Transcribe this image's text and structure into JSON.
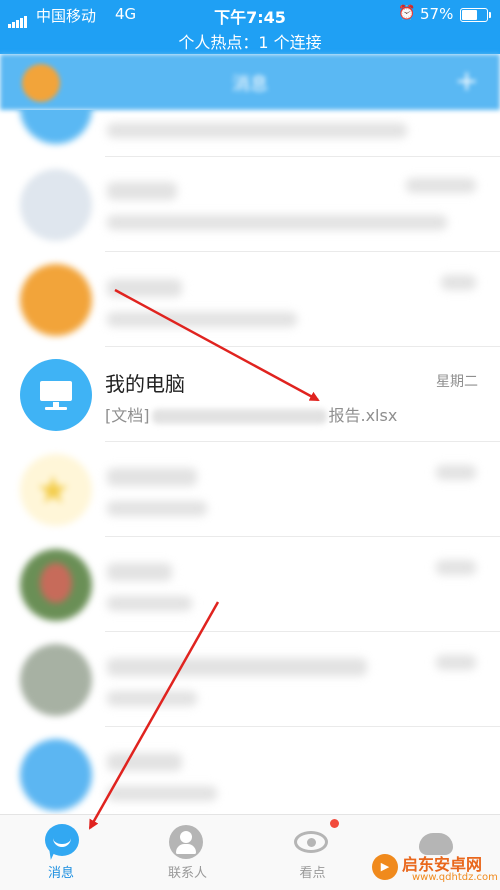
{
  "status_bar": {
    "carrier": "中国移动",
    "network": "4G",
    "time": "下午7:45",
    "battery_percent": "57%",
    "battery_level": 0.57,
    "hotspot_text": "个人热点：1 个连接",
    "alarm_icon": "alarm-clock-icon",
    "signal_bars": 5
  },
  "header": {
    "title": "消息",
    "add_icon": "plus-icon"
  },
  "conversations": [
    {
      "id": "partial-top",
      "name": "",
      "preview": "",
      "time": "",
      "blurred": true,
      "avatar_color": "#5ab8f3"
    },
    {
      "id": "contact-1",
      "name": "",
      "preview": "",
      "time": "",
      "blurred": true,
      "avatar_color": "#dfe6ee"
    },
    {
      "id": "contact-2",
      "name": "",
      "preview": "",
      "time": "",
      "blurred": true,
      "avatar_color": "#f2a43a"
    },
    {
      "id": "my-computer",
      "name": "我的电脑",
      "preview_prefix": "[文档]",
      "preview_suffix": "报告.xlsx",
      "time": "星期二",
      "blurred": false,
      "avatar_color": "#3fb3f5",
      "avatar_icon": "monitor-icon"
    },
    {
      "id": "contact-4",
      "name": "",
      "preview": "",
      "time": "",
      "blurred": true,
      "avatar_color": "#f3cd4c"
    },
    {
      "id": "contact-5",
      "name": "",
      "preview": "",
      "time": "",
      "blurred": true,
      "avatar_color": "#6a8f56"
    },
    {
      "id": "contact-6",
      "name": "",
      "preview": "",
      "time": "",
      "blurred": true,
      "avatar_color": "#a7b1a3"
    },
    {
      "id": "contact-7",
      "name": "",
      "preview": "",
      "time": "",
      "blurred": true,
      "avatar_color": "#5cb6f2"
    }
  ],
  "tabs": [
    {
      "label": "消息",
      "icon": "message-bubble-icon",
      "active": true
    },
    {
      "label": "联系人",
      "icon": "contacts-icon",
      "active": false
    },
    {
      "label": "看点",
      "icon": "eye-icon",
      "active": false,
      "badge": true
    },
    {
      "label": "",
      "icon": "cloud-icon",
      "active": false
    }
  ],
  "watermark": {
    "name": "启东安卓网",
    "url": "www.qdhtdz.com"
  },
  "colors": {
    "status_bar": "#1fa0f4",
    "accent": "#1c8fe0",
    "arrow": "#e0231f",
    "badge": "#f24b3c"
  }
}
